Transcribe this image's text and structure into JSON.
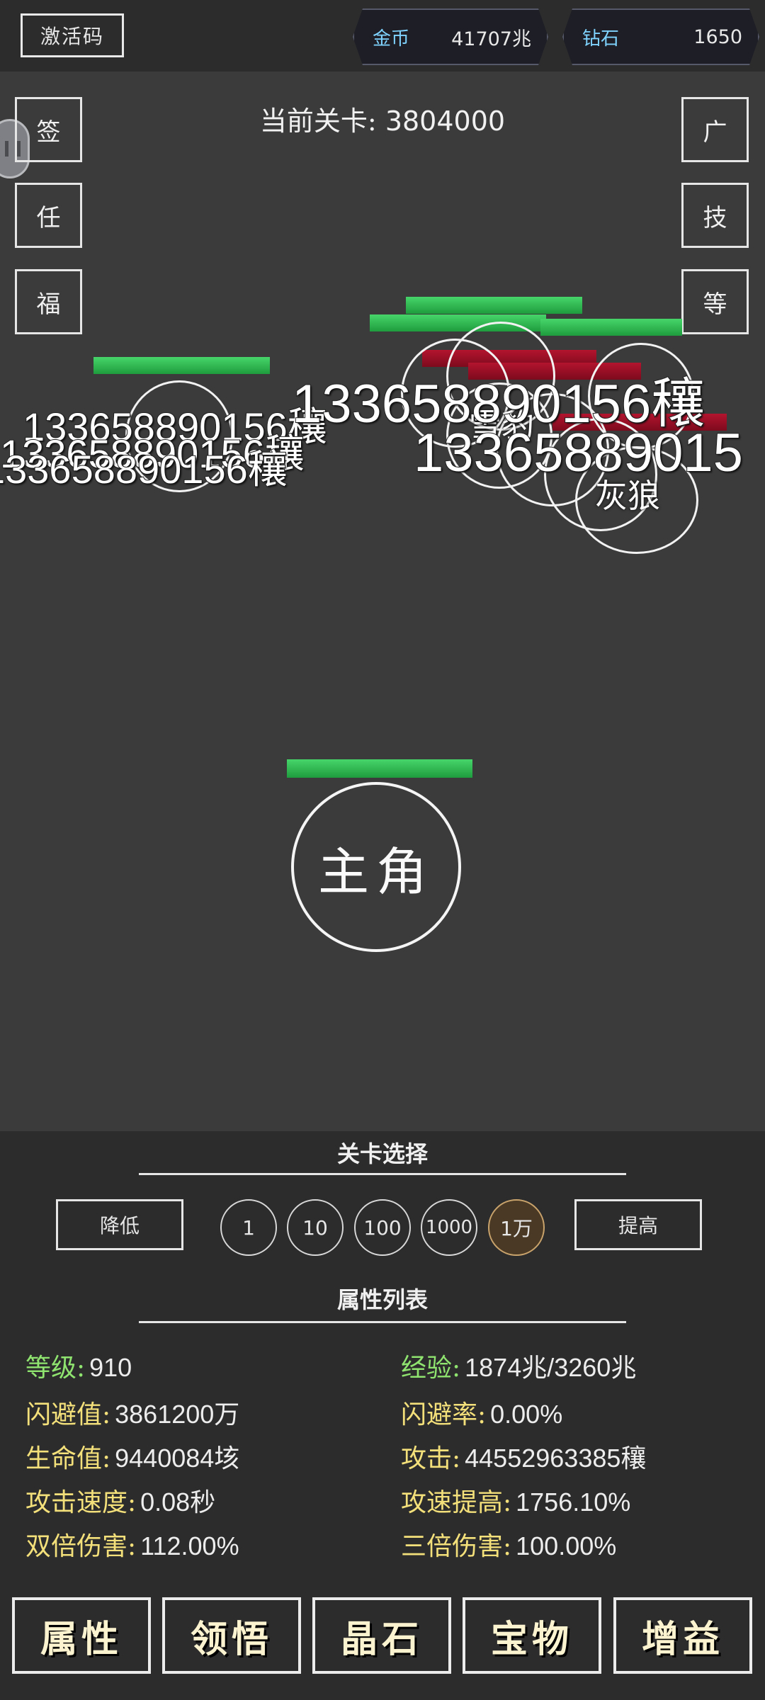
{
  "header": {
    "activate_label": "激活码",
    "gold": {
      "label": "金币",
      "value": "41707兆"
    },
    "diamond": {
      "label": "钻石",
      "value": "1650"
    }
  },
  "left_buttons": [
    "签",
    "任",
    "福"
  ],
  "right_buttons": [
    "广",
    "技",
    "等"
  ],
  "stage": {
    "label": "当前关卡:",
    "value": "3804000"
  },
  "enemies": [
    "雪豹",
    "灰狼"
  ],
  "damage_text": "133658890156穰",
  "damage_text_cut": "13365889015",
  "hero_label": "主角",
  "stage_select": {
    "title": "关卡选择",
    "decrease": "降低",
    "increase": "提高",
    "steps": [
      "1",
      "10",
      "100",
      "1000",
      "1万"
    ],
    "active_step": "1万"
  },
  "attributes": {
    "title": "属性列表",
    "items": [
      {
        "key": "等级:",
        "value": "910"
      },
      {
        "key": "经验:",
        "value": "1874兆/3260兆"
      },
      {
        "key": "闪避值:",
        "value": "3861200万"
      },
      {
        "key": "闪避率:",
        "value": "0.00%"
      },
      {
        "key": "生命值:",
        "value": "9440084垓"
      },
      {
        "key": "攻击:",
        "value": "44552963385穰"
      },
      {
        "key": "攻击速度:",
        "value": "0.08秒"
      },
      {
        "key": "攻速提高:",
        "value": "1756.10%"
      },
      {
        "key": "双倍伤害:",
        "value": "112.00%"
      },
      {
        "key": "三倍伤害:",
        "value": "100.00%"
      }
    ]
  },
  "bottom_nav": [
    "属性",
    "领悟",
    "晶石",
    "宝物",
    "增益"
  ],
  "colors": {
    "accent_gold": "#f4e07a",
    "accent_green": "#8fe36f",
    "hp_green": "#2dbb4f",
    "hp_red": "#a3112a",
    "currency_label": "#7fd3ff"
  }
}
